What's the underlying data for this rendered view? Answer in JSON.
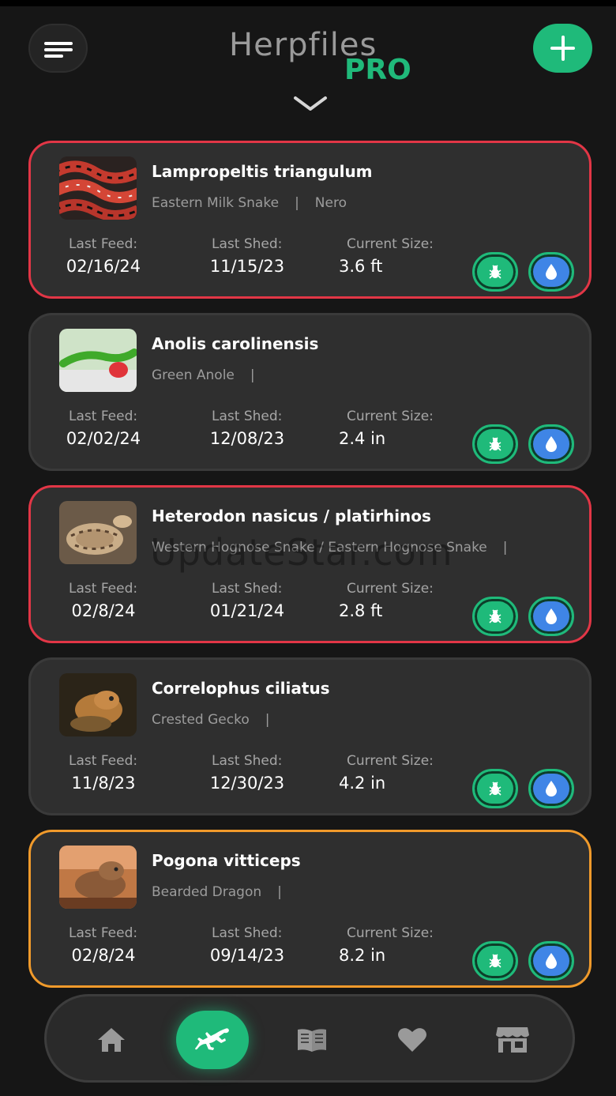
{
  "header": {
    "app_name": "Herpfiles",
    "badge": "PRO",
    "menu_icon": "hamburger-menu-icon",
    "add_icon": "plus-icon",
    "expand_icon": "chevron-down-icon"
  },
  "labels": {
    "last_feed": "Last Feed:",
    "last_shed": "Last Shed:",
    "current_size": "Current Size:"
  },
  "animals": [
    {
      "scientific": "Lampropeltis triangulum",
      "common": "Eastern Milk Snake",
      "separator": "|",
      "nickname": "Nero",
      "last_feed": "02/16/24",
      "last_shed": "11/15/23",
      "size": "3.6 ft",
      "status": "red"
    },
    {
      "scientific": "Anolis carolinensis",
      "common": "Green Anole",
      "separator": "|",
      "nickname": "",
      "last_feed": "02/02/24",
      "last_shed": "12/08/23",
      "size": "2.4 in",
      "status": "normal"
    },
    {
      "scientific": "Heterodon nasicus / platirhinos",
      "common": "Western Hognose Snake / Eastern Hognose Snake",
      "separator": "|",
      "nickname": "",
      "last_feed": "02/8/24",
      "last_shed": "01/21/24",
      "size": "2.8 ft",
      "status": "red"
    },
    {
      "scientific": "Correlophus ciliatus",
      "common": "Crested Gecko",
      "separator": "|",
      "nickname": "",
      "last_feed": "11/8/23",
      "last_shed": "12/30/23",
      "size": "4.2 in",
      "status": "normal"
    },
    {
      "scientific": "Pogona vitticeps",
      "common": "Bearded Dragon",
      "separator": "|",
      "nickname": "",
      "last_feed": "02/8/24",
      "last_shed": "09/14/23",
      "size": "8.2 in",
      "status": "orange"
    }
  ],
  "card_actions": {
    "feed_icon": "bug-icon",
    "water_icon": "water-drop-icon"
  },
  "watermark": "UpdateStar.com",
  "nav": [
    {
      "icon": "home-icon",
      "active": false
    },
    {
      "icon": "lizard-icon",
      "active": true
    },
    {
      "icon": "book-icon",
      "active": false
    },
    {
      "icon": "heart-icon",
      "active": false
    },
    {
      "icon": "store-icon",
      "active": false
    }
  ],
  "colors": {
    "accent": "#1fba7a",
    "alert_red": "#e23646",
    "alert_orange": "#f09a2b",
    "water_blue": "#3f85e6",
    "card_bg": "#2f2f2f",
    "page_bg": "#161616"
  }
}
